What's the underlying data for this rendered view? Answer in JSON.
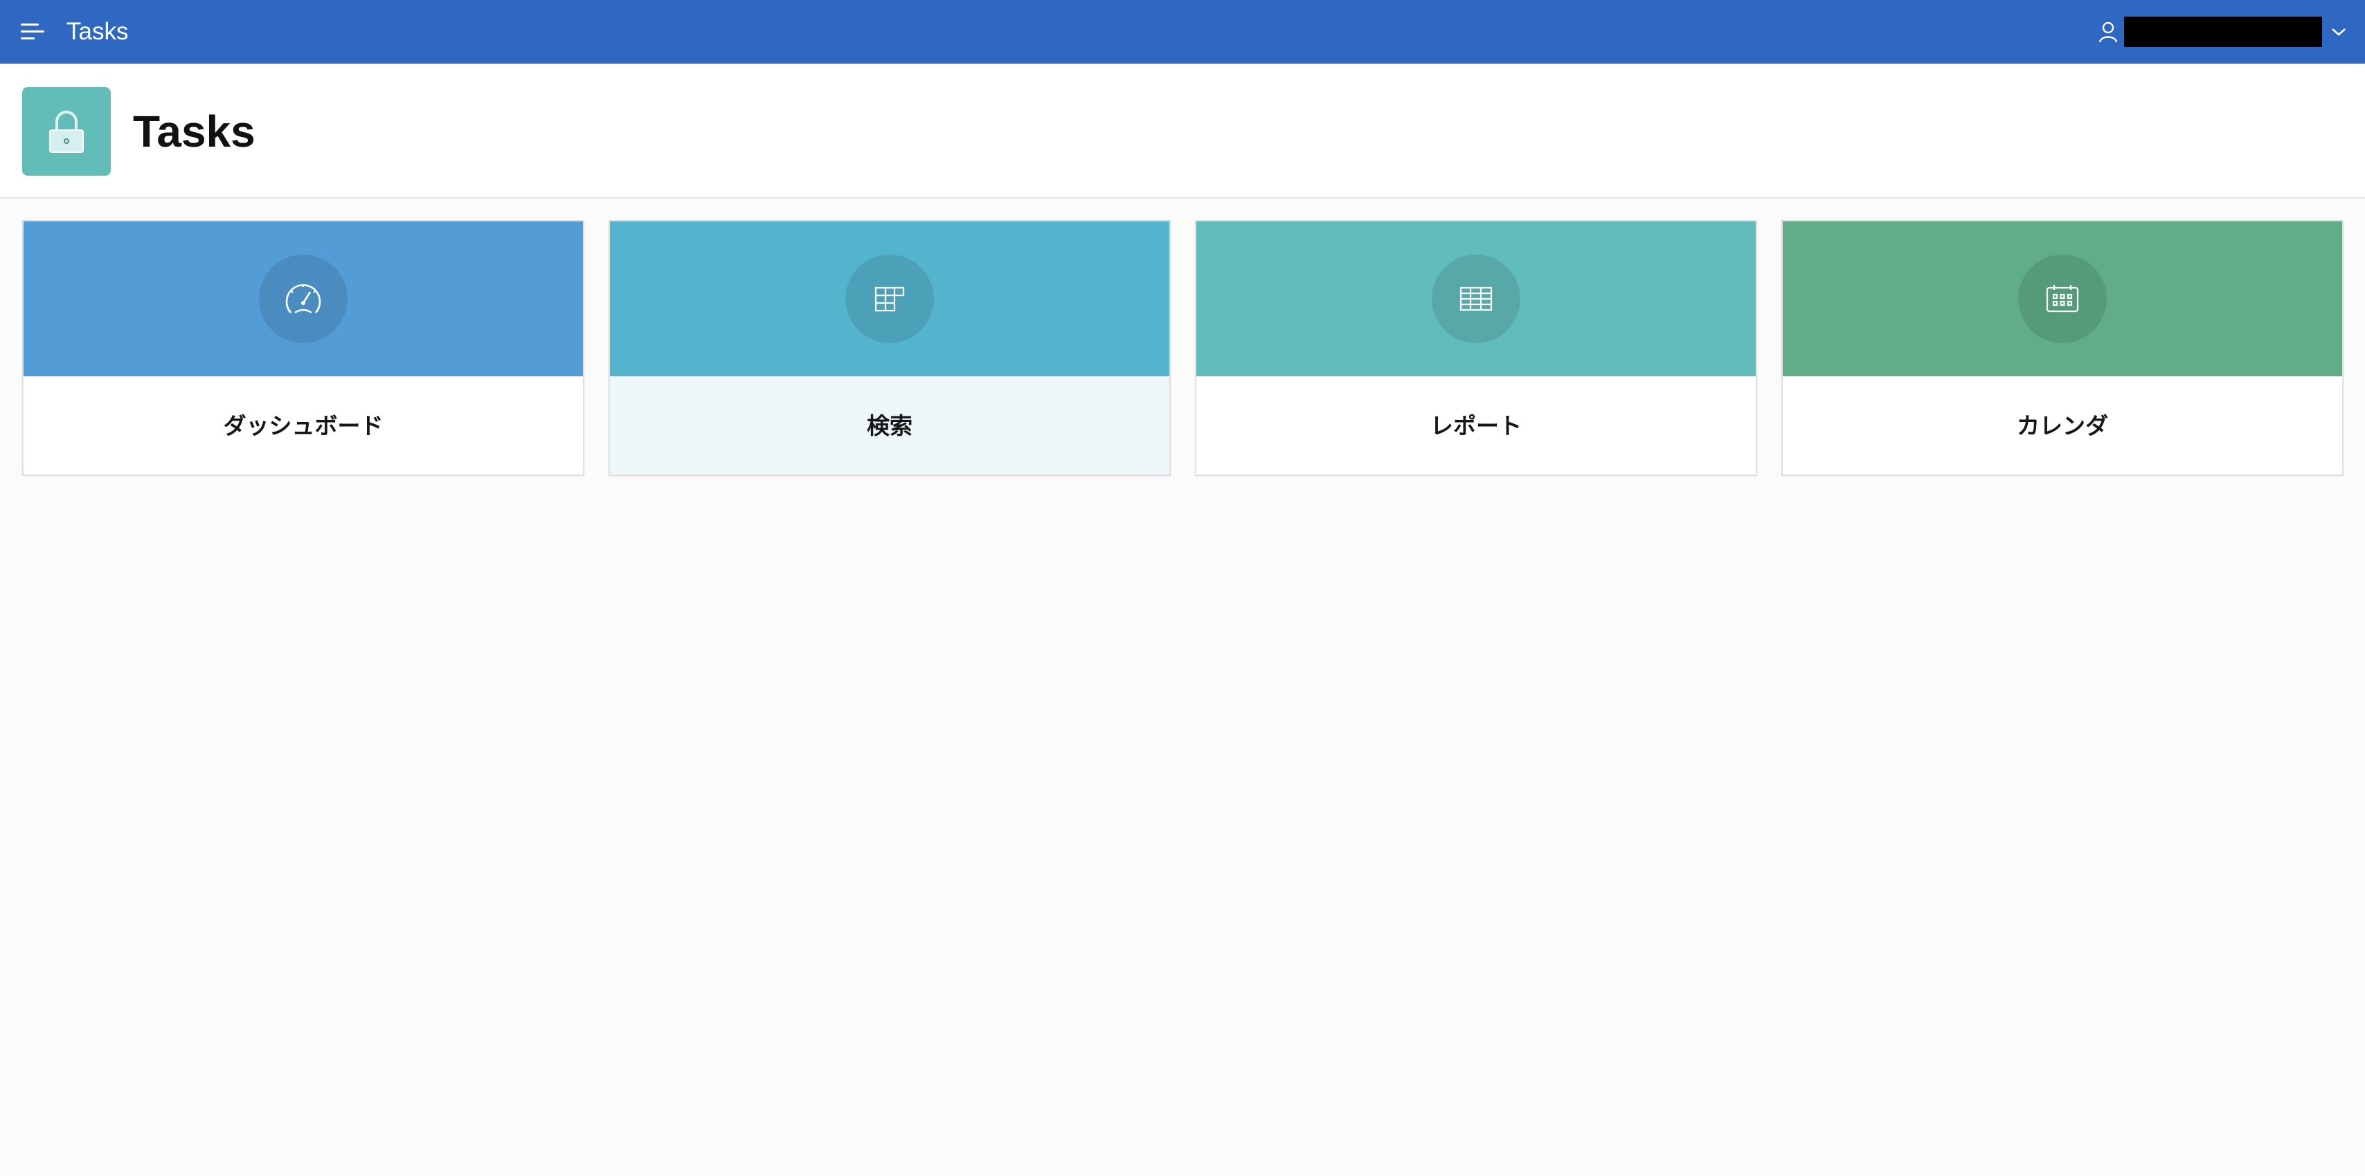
{
  "header": {
    "app_title": "Tasks",
    "menu_icon": "hamburger-menu-icon",
    "user": {
      "icon": "user-icon",
      "name": "",
      "dropdown_icon": "chevron-down-icon"
    }
  },
  "page": {
    "icon": "padlock-icon",
    "title": "Tasks"
  },
  "cards": [
    {
      "label": "ダッシュボード",
      "icon": "speedometer-icon",
      "color": "#549cd6"
    },
    {
      "label": "検索",
      "icon": "table-search-icon",
      "color": "#55b4cd"
    },
    {
      "label": "レポート",
      "icon": "grid-table-icon",
      "color": "#62bcbb"
    },
    {
      "label": "カレンダ",
      "icon": "calendar-icon",
      "color": "#60ad87"
    }
  ],
  "colors": {
    "header": "#2f68c2",
    "title_icon": "#62bcb8",
    "background": "#fbfbfb"
  }
}
